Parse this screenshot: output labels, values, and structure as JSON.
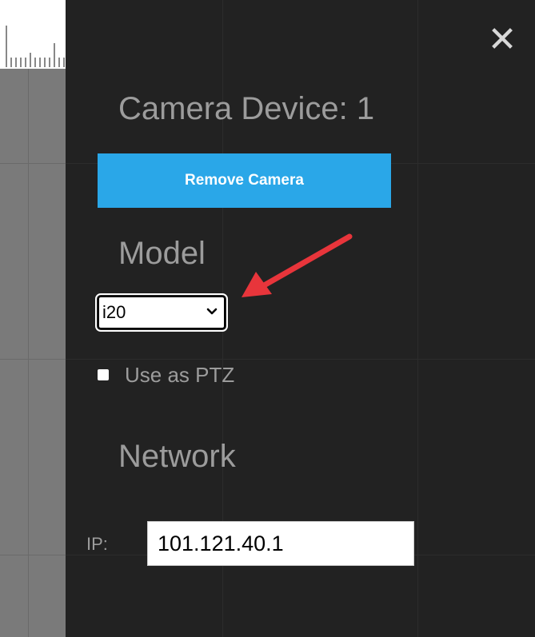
{
  "panel": {
    "title": "Camera Device: 1",
    "close_label": "✕"
  },
  "remove_button": {
    "label": "Remove Camera"
  },
  "model": {
    "heading": "Model",
    "selected": "i20",
    "options": [
      "i20"
    ]
  },
  "ptz": {
    "label": "Use as PTZ",
    "checked": false
  },
  "network": {
    "heading": "Network",
    "ip_label": "IP:",
    "ip_value": "101.121.40.1"
  },
  "colors": {
    "panel_bg": "#222222",
    "accent": "#2aa7e8",
    "text": "#9c9c9c",
    "annotation": "#e8353b"
  },
  "icons": {
    "close": "close-icon",
    "dropdown": "chevron-down-icon",
    "annotation": "red-arrow-annotation"
  }
}
